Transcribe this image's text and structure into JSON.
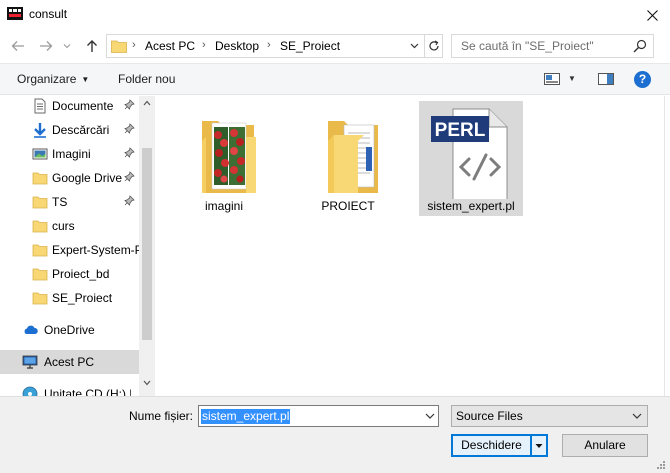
{
  "window": {
    "title": "consult",
    "close_label": "×"
  },
  "address": {
    "crumbs": [
      "Acest PC",
      "Desktop",
      "SE_Proiect"
    ],
    "search_placeholder": "Se caută în \"SE_Proiect\""
  },
  "toolbar": {
    "organize_label": "Organizare",
    "new_folder_label": "Folder nou",
    "help_label": "?"
  },
  "sidebar": {
    "items": [
      {
        "label": "Documente",
        "icon": "document-icon",
        "pinned": true
      },
      {
        "label": "Descărcări",
        "icon": "download-icon",
        "pinned": true
      },
      {
        "label": "Imagini",
        "icon": "pictures-icon",
        "pinned": true
      },
      {
        "label": "Google Drive",
        "icon": "folder-icon",
        "pinned": true
      },
      {
        "label": "TS",
        "icon": "folder-icon",
        "pinned": true
      },
      {
        "label": "curs",
        "icon": "folder-icon",
        "pinned": false
      },
      {
        "label": "Expert-System-P",
        "icon": "folder-icon",
        "pinned": false
      },
      {
        "label": "Proiect_bd",
        "icon": "folder-icon",
        "pinned": false
      },
      {
        "label": "SE_Proiect",
        "icon": "folder-icon",
        "pinned": false
      },
      {
        "label": "OneDrive",
        "icon": "cloud-icon",
        "pinned": false
      },
      {
        "label": "Acest PC",
        "icon": "computer-icon",
        "pinned": false,
        "selected": true
      },
      {
        "label": "Unitate CD (H:) Ui",
        "icon": "cd-drive-icon",
        "pinned": false
      }
    ]
  },
  "files": [
    {
      "label": "imagini",
      "icon": "folder-with-images-icon"
    },
    {
      "label": "PROIECT",
      "icon": "folder-with-documents-icon"
    },
    {
      "label": "sistem_expert.pl",
      "icon": "perl-file-icon",
      "badge": "PERL",
      "selected": true
    }
  ],
  "footer": {
    "filename_label": "Nume fișier:",
    "filename_value": "sistem_expert.pl",
    "filter_value": "Source Files",
    "open_label": "Deschidere",
    "cancel_label": "Anulare"
  },
  "colors": {
    "selection": "#cce8ff",
    "accent": "#0078d7",
    "perl_badge": "#1f3b7a"
  }
}
